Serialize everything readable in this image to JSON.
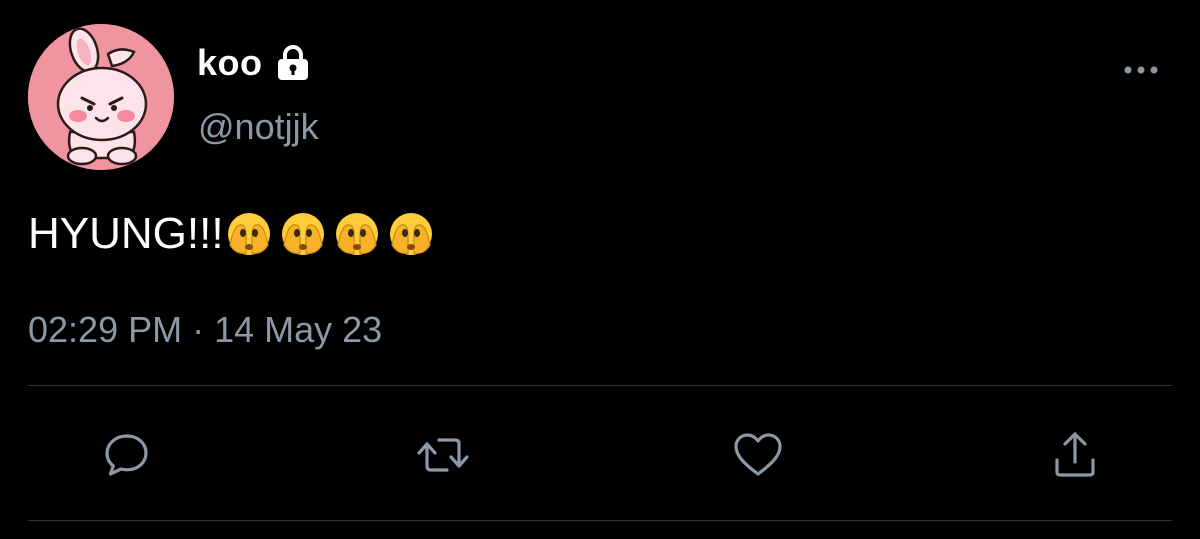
{
  "user": {
    "display_name": "koo",
    "handle": "@notjjk",
    "protected_icon": "lock-icon",
    "avatar_icon": "pink-bunny-character-avatar"
  },
  "tweet": {
    "text": "HYUNG!!!",
    "emoji_count": 4,
    "emoji_icon": "face-with-hands-over-eyes-emoji",
    "timestamp": "02:29 PM · 14 May 23"
  },
  "actions": {
    "reply_icon": "speech-bubble-icon",
    "retweet_icon": "retweet-icon",
    "like_icon": "heart-icon",
    "share_icon": "share-upload-icon",
    "more_icon": "more-options-dots-icon"
  },
  "colors": {
    "background": "#000000",
    "primary_text": "#ffffff",
    "secondary_text": "#8b98a5",
    "divider": "#2f3336",
    "avatar_bg": "#f0949f"
  }
}
